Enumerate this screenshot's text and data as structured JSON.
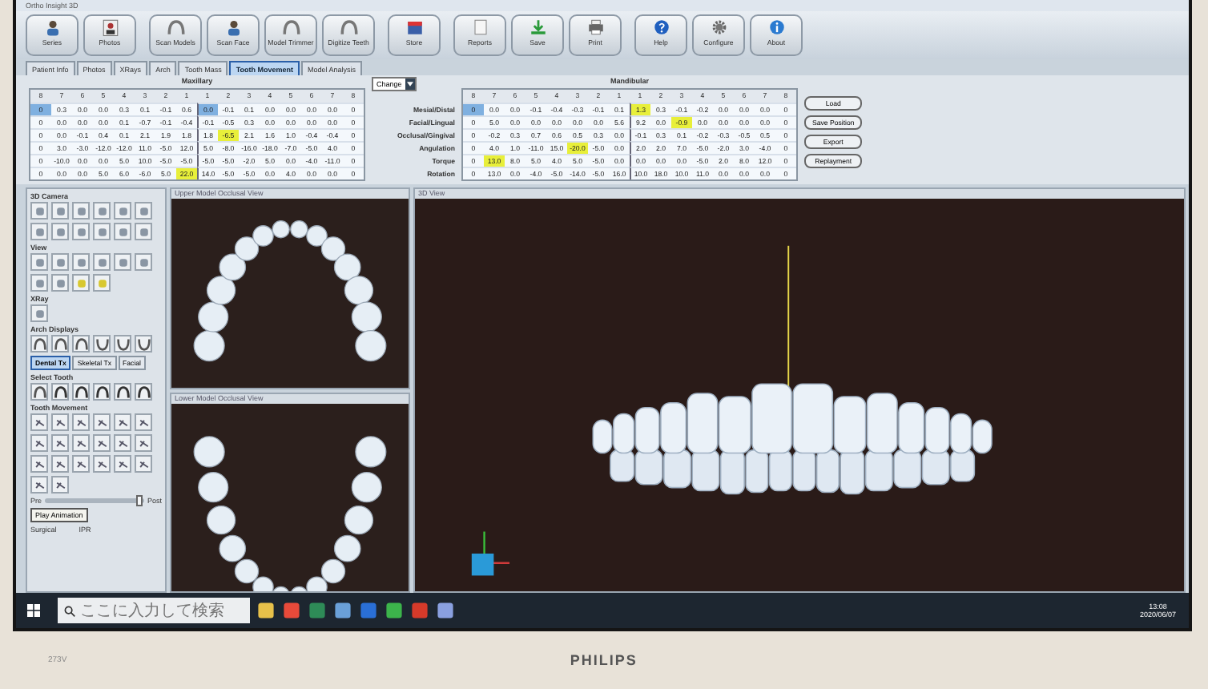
{
  "window": {
    "title": "Ortho Insight 3D"
  },
  "toolbar": [
    {
      "label": "Series"
    },
    {
      "label": "Photos"
    },
    {
      "label": "Scan Models"
    },
    {
      "label": "Scan Face"
    },
    {
      "label": "Model Trimmer"
    },
    {
      "label": "Digitize Teeth"
    },
    {
      "label": "Store"
    },
    {
      "label": "Reports"
    },
    {
      "label": "Save"
    },
    {
      "label": "Print"
    },
    {
      "label": "Help"
    },
    {
      "label": "Configure"
    },
    {
      "label": "About"
    }
  ],
  "tabs": [
    {
      "label": "Patient Info",
      "selected": false
    },
    {
      "label": "Photos",
      "selected": false
    },
    {
      "label": "XRays",
      "selected": false
    },
    {
      "label": "Arch",
      "selected": false
    },
    {
      "label": "Tooth Mass",
      "selected": false
    },
    {
      "label": "Tooth Movement",
      "selected": true
    },
    {
      "label": "Model Analysis",
      "selected": false
    }
  ],
  "maxillary": {
    "title": "Maxillary",
    "columns": [
      "8",
      "7",
      "6",
      "5",
      "4",
      "3",
      "2",
      "1",
      "1",
      "2",
      "3",
      "4",
      "5",
      "6",
      "7",
      "8"
    ],
    "rows": [
      {
        "cells": [
          "0",
          "0.3",
          "0.0",
          "0.0",
          "0.3",
          "0.1",
          "-0.1",
          "0.6",
          "0.0",
          "-0.1",
          "0.1",
          "0.0",
          "0.0",
          "0.0",
          "0.0",
          "0"
        ],
        "highlighted": [
          false,
          false,
          false,
          false,
          false,
          false,
          false,
          false,
          false,
          false,
          false,
          false,
          false,
          false,
          false,
          false
        ],
        "selected": [
          true,
          false,
          false,
          false,
          false,
          false,
          false,
          false,
          true,
          false,
          false,
          false,
          false,
          false,
          false,
          false
        ]
      },
      {
        "cells": [
          "0",
          "0.0",
          "0.0",
          "0.0",
          "0.1",
          "-0.7",
          "-0.1",
          "-0.4",
          "-0.1",
          "-0.5",
          "0.3",
          "0.0",
          "0.0",
          "0.0",
          "0.0",
          "0"
        ],
        "highlighted": [
          false,
          false,
          false,
          false,
          false,
          false,
          false,
          false,
          false,
          false,
          false,
          false,
          false,
          false,
          false,
          false
        ],
        "selected": [
          false,
          false,
          false,
          false,
          false,
          false,
          false,
          false,
          false,
          false,
          false,
          false,
          false,
          false,
          false,
          false
        ]
      },
      {
        "cells": [
          "0",
          "0.0",
          "-0.1",
          "0.4",
          "0.1",
          "2.1",
          "1.9",
          "1.8",
          "1.8",
          "-6.5",
          "2.1",
          "1.6",
          "1.0",
          "-0.4",
          "-0.4",
          "0"
        ],
        "highlighted": [
          false,
          false,
          false,
          false,
          false,
          false,
          false,
          false,
          false,
          true,
          false,
          false,
          false,
          false,
          false,
          false
        ],
        "selected": [
          false,
          false,
          false,
          false,
          false,
          false,
          false,
          false,
          false,
          false,
          false,
          false,
          false,
          false,
          false,
          false
        ]
      },
      {
        "cells": [
          "0",
          "3.0",
          "-3.0",
          "-12.0",
          "-12.0",
          "11.0",
          "-5.0",
          "12.0",
          "5.0",
          "-8.0",
          "-16.0",
          "-18.0",
          "-7.0",
          "-5.0",
          "4.0",
          "0"
        ],
        "highlighted": [
          false,
          false,
          false,
          false,
          false,
          false,
          false,
          false,
          false,
          false,
          false,
          false,
          false,
          false,
          false,
          false
        ],
        "selected": [
          false,
          false,
          false,
          false,
          false,
          false,
          false,
          false,
          false,
          false,
          false,
          false,
          false,
          false,
          false,
          false
        ]
      },
      {
        "cells": [
          "0",
          "-10.0",
          "0.0",
          "0.0",
          "5.0",
          "10.0",
          "-5.0",
          "-5.0",
          "-5.0",
          "-5.0",
          "-2.0",
          "5.0",
          "0.0",
          "-4.0",
          "-11.0",
          "0"
        ],
        "highlighted": [
          false,
          false,
          false,
          false,
          false,
          false,
          false,
          false,
          false,
          false,
          false,
          false,
          false,
          false,
          false,
          false
        ],
        "selected": [
          false,
          false,
          false,
          false,
          false,
          false,
          false,
          false,
          false,
          false,
          false,
          false,
          false,
          false,
          false,
          false
        ]
      },
      {
        "cells": [
          "0",
          "0.0",
          "0.0",
          "5.0",
          "6.0",
          "-6.0",
          "5.0",
          "22.0",
          "14.0",
          "-5.0",
          "-5.0",
          "0.0",
          "4.0",
          "0.0",
          "0.0",
          "0"
        ],
        "highlighted": [
          false,
          false,
          false,
          false,
          false,
          false,
          false,
          true,
          false,
          false,
          false,
          false,
          false,
          false,
          false,
          false
        ],
        "selected": [
          false,
          false,
          false,
          false,
          false,
          false,
          false,
          false,
          false,
          false,
          false,
          false,
          false,
          false,
          false,
          false
        ]
      }
    ]
  },
  "measure_select": {
    "value": "Change"
  },
  "row_labels": [
    "Mesial/Distal",
    "Facial/Lingual",
    "Occlusal/Gingival",
    "Angulation",
    "Torque",
    "Rotation"
  ],
  "mandibular": {
    "title": "Mandibular",
    "columns": [
      "8",
      "7",
      "6",
      "5",
      "4",
      "3",
      "2",
      "1",
      "1",
      "2",
      "3",
      "4",
      "5",
      "6",
      "7",
      "8"
    ],
    "rows": [
      {
        "cells": [
          "0",
          "0.0",
          "0.0",
          "-0.1",
          "-0.4",
          "-0.3",
          "-0.1",
          "0.1",
          "1.3",
          "0.3",
          "-0.1",
          "-0.2",
          "0.0",
          "0.0",
          "0.0",
          "0"
        ],
        "highlighted": [
          false,
          false,
          false,
          false,
          false,
          false,
          false,
          false,
          true,
          false,
          false,
          false,
          false,
          false,
          false,
          false
        ],
        "selected": [
          true,
          false,
          false,
          false,
          false,
          false,
          false,
          false,
          false,
          false,
          false,
          false,
          false,
          false,
          false,
          false
        ]
      },
      {
        "cells": [
          "0",
          "5.0",
          "0.0",
          "0.0",
          "0.0",
          "0.0",
          "0.0",
          "5.6",
          "9.2",
          "0.0",
          "-0.9",
          "0.0",
          "0.0",
          "0.0",
          "0.0",
          "0"
        ],
        "highlighted": [
          false,
          false,
          false,
          false,
          false,
          false,
          false,
          false,
          false,
          false,
          true,
          false,
          false,
          false,
          false,
          false
        ],
        "selected": [
          false,
          false,
          false,
          false,
          false,
          false,
          false,
          false,
          false,
          false,
          false,
          false,
          false,
          false,
          false,
          false
        ]
      },
      {
        "cells": [
          "0",
          "-0.2",
          "0.3",
          "0.7",
          "0.6",
          "0.5",
          "0.3",
          "0.0",
          "-0.1",
          "0.3",
          "0.1",
          "-0.2",
          "-0.3",
          "-0.5",
          "0.5",
          "0"
        ],
        "highlighted": [
          false,
          false,
          false,
          false,
          false,
          false,
          false,
          false,
          false,
          false,
          false,
          false,
          false,
          false,
          false,
          false
        ],
        "selected": [
          false,
          false,
          false,
          false,
          false,
          false,
          false,
          false,
          false,
          false,
          false,
          false,
          false,
          false,
          false,
          false
        ]
      },
      {
        "cells": [
          "0",
          "4.0",
          "1.0",
          "-11.0",
          "15.0",
          "-20.0",
          "-5.0",
          "0.0",
          "2.0",
          "2.0",
          "7.0",
          "-5.0",
          "-2.0",
          "3.0",
          "-4.0",
          "0"
        ],
        "highlighted": [
          false,
          false,
          false,
          false,
          false,
          true,
          false,
          false,
          false,
          false,
          false,
          false,
          false,
          false,
          false,
          false
        ],
        "selected": [
          false,
          false,
          false,
          false,
          false,
          false,
          false,
          false,
          false,
          false,
          false,
          false,
          false,
          false,
          false,
          false
        ]
      },
      {
        "cells": [
          "0",
          "13.0",
          "8.0",
          "5.0",
          "4.0",
          "5.0",
          "-5.0",
          "0.0",
          "0.0",
          "0.0",
          "0.0",
          "-5.0",
          "2.0",
          "8.0",
          "12.0",
          "0"
        ],
        "highlighted": [
          false,
          true,
          false,
          false,
          false,
          false,
          false,
          false,
          false,
          false,
          false,
          false,
          false,
          false,
          false,
          false
        ],
        "selected": [
          false,
          false,
          false,
          false,
          false,
          false,
          false,
          false,
          false,
          false,
          false,
          false,
          false,
          false,
          false,
          false
        ]
      },
      {
        "cells": [
          "0",
          "13.0",
          "0.0",
          "-4.0",
          "-5.0",
          "-14.0",
          "-5.0",
          "16.0",
          "10.0",
          "18.0",
          "10.0",
          "11.0",
          "0.0",
          "0.0",
          "0.0",
          "0"
        ],
        "highlighted": [
          false,
          false,
          false,
          false,
          false,
          false,
          false,
          false,
          false,
          false,
          false,
          false,
          false,
          false,
          false,
          false
        ],
        "selected": [
          false,
          false,
          false,
          false,
          false,
          false,
          false,
          false,
          false,
          false,
          false,
          false,
          false,
          false,
          false,
          false
        ]
      }
    ]
  },
  "actions": [
    "Load",
    "Save Position",
    "Export",
    "Replayment"
  ],
  "left_panel": {
    "sections": [
      {
        "title": "3D Camera"
      },
      {
        "title": "View"
      },
      {
        "title": "XRay"
      },
      {
        "title": "Arch Displays"
      }
    ],
    "tabs": [
      {
        "label": "Dental Tx",
        "selected": true
      },
      {
        "label": "Skeletal Tx",
        "selected": false
      },
      {
        "label": "Facial",
        "selected": false
      }
    ],
    "groups": [
      {
        "title": "Select Tooth"
      },
      {
        "title": "Tooth Movement"
      }
    ],
    "slider": {
      "start_label": "Pre",
      "end_label": "Post",
      "level": 0.95
    },
    "tooltip": "Play Animation",
    "footer_labels": [
      "Surgical",
      "IPR"
    ]
  },
  "viewports": {
    "upper": "Upper Model Occlusal View",
    "lower": "Lower Model Occlusal View",
    "main": "3D View"
  },
  "taskbar": {
    "search_placeholder": "ここに入力して検索",
    "time": "13:08",
    "date": "2020/06/07"
  },
  "monitor": {
    "model": "273V",
    "brand": "PHILIPS"
  }
}
